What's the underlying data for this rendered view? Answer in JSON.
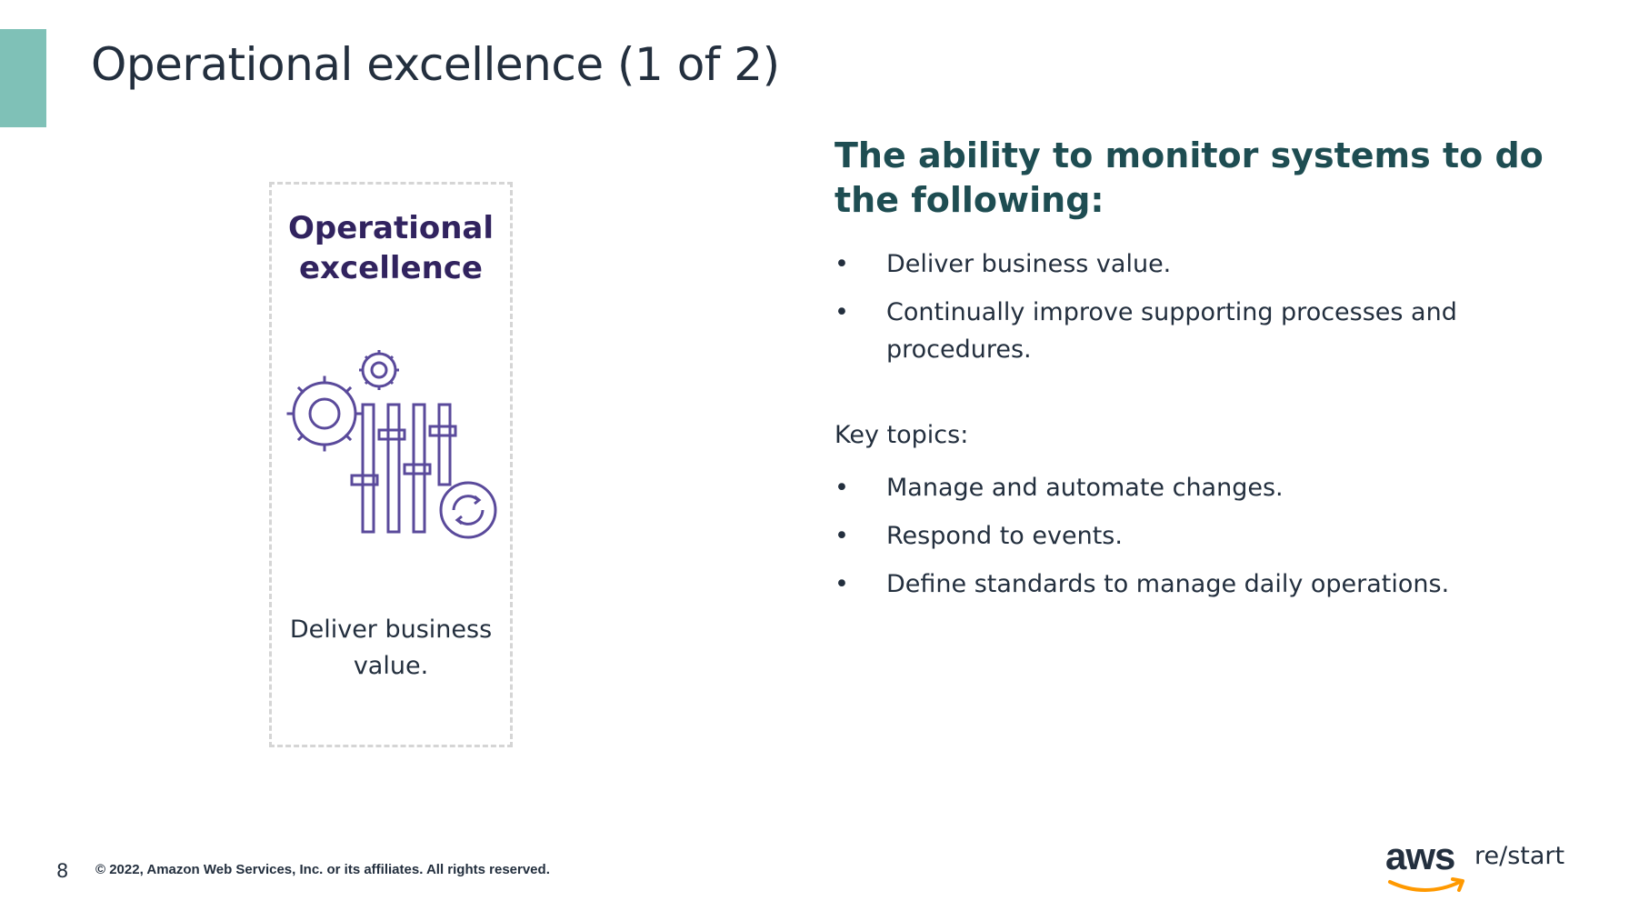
{
  "slide": {
    "title": "Operational excellence (1 of 2)",
    "page_number": "8",
    "copyright": "© 2022, Amazon Web Services, Inc. or its affiliates. All rights reserved.",
    "accent_color": "#7fc1b7"
  },
  "card": {
    "heading": "Operational excellence",
    "icon": "gears-sliders-refresh-icon",
    "caption": "Deliver business value.",
    "icon_color": "#5a4a9b"
  },
  "content": {
    "subheading": "The ability to monitor systems to do the following:",
    "bullets": [
      "Deliver business value.",
      "Continually improve supporting processes and procedures."
    ],
    "key_topics_label": "Key topics:",
    "topics": [
      "Manage and automate changes.",
      "Respond to events.",
      "Define standards to manage daily operations."
    ]
  },
  "brand": {
    "logo_text": "aws",
    "product": "re/start",
    "smile_color": "#ff9900"
  }
}
